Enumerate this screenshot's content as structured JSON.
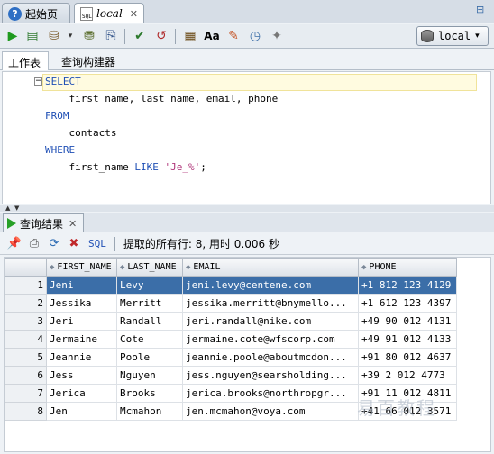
{
  "tabs": [
    {
      "label": "起始页"
    },
    {
      "label": "local"
    }
  ],
  "connection": {
    "label": "local"
  },
  "subtabs": {
    "worksheet": "工作表",
    "query_builder": "查询构建器"
  },
  "editor": {
    "kw_select": "SELECT",
    "line2": "    first_name, last_name, email, phone",
    "kw_from": "FROM",
    "line4": "    contacts",
    "kw_where": "WHERE",
    "line6_a": "    first_name ",
    "line6_like": "LIKE",
    "line6_sp": " ",
    "line6_str": "'Je_%'",
    "line6_end": ";"
  },
  "results": {
    "tab_label": "查询结果",
    "sql_link": "SQL",
    "status": "提取的所有行: 8, 用时 0.006 秒",
    "columns": [
      "FIRST_NAME",
      "LAST_NAME",
      "EMAIL",
      "PHONE"
    ],
    "rows": [
      {
        "n": "1",
        "first": "Jeni",
        "last": "Levy",
        "email": "jeni.levy@centene.com",
        "phone": "+1 812 123 4129"
      },
      {
        "n": "2",
        "first": "Jessika",
        "last": "Merritt",
        "email": "jessika.merritt@bnymello...",
        "phone": "+1 612 123 4397"
      },
      {
        "n": "3",
        "first": "Jeri",
        "last": "Randall",
        "email": "jeri.randall@nike.com",
        "phone": "+49 90 012 4131"
      },
      {
        "n": "4",
        "first": "Jermaine",
        "last": "Cote",
        "email": "jermaine.cote@wfscorp.com",
        "phone": "+49 91 012 4133"
      },
      {
        "n": "5",
        "first": "Jeannie",
        "last": "Poole",
        "email": "jeannie.poole@aboutmcdon...",
        "phone": "+91 80 012 4637"
      },
      {
        "n": "6",
        "first": "Jess",
        "last": "Nguyen",
        "email": "jess.nguyen@searsholding...",
        "phone": "+39 2 012 4773"
      },
      {
        "n": "7",
        "first": "Jerica",
        "last": "Brooks",
        "email": "jerica.brooks@northropgr...",
        "phone": "+91 11 012 4811"
      },
      {
        "n": "8",
        "first": "Jen",
        "last": "Mcmahon",
        "email": "jen.mcmahon@voya.com",
        "phone": "+41 66 012 3571"
      }
    ]
  },
  "watermark": "易百教程",
  "colors": {
    "selection": "#3b6ea8",
    "keyword": "#1f4fb5",
    "string": "#b0367a"
  }
}
